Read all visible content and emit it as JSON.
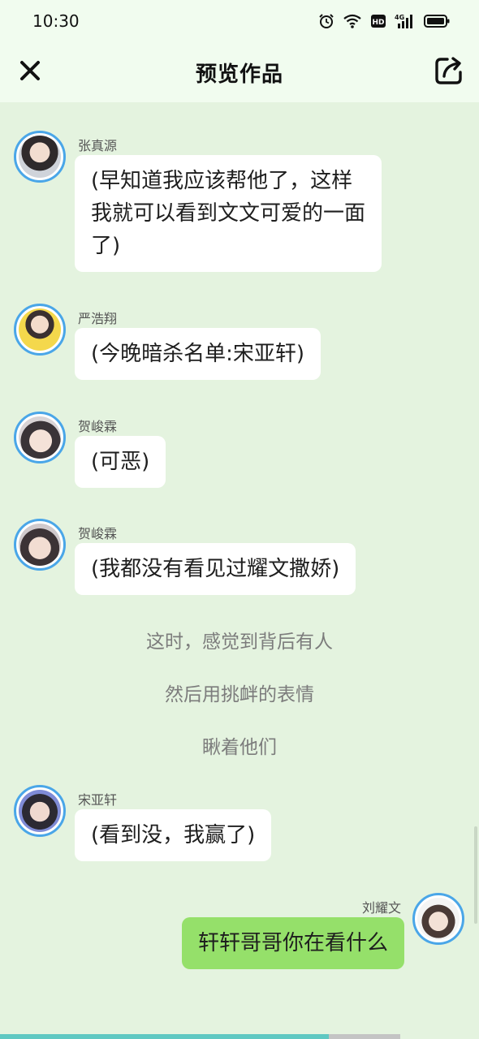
{
  "status_bar": {
    "time": "10:30",
    "icons": [
      "alarm-icon",
      "wifi-icon",
      "hd-icon",
      "signal-4g-icon",
      "battery-icon"
    ],
    "network_label": "4G",
    "hd_label": "HD"
  },
  "header": {
    "title": "预览作品",
    "close_icon": "close-icon",
    "share_icon": "share-icon"
  },
  "messages": [
    {
      "type": "left",
      "sender": "张真源",
      "lines": [
        "(早知道我应该帮他了，这样",
        "我就可以看到文文可爱的一面",
        "了)"
      ]
    },
    {
      "type": "left",
      "sender": "严浩翔",
      "lines": [
        "(今晚暗杀名单:宋亚轩)"
      ]
    },
    {
      "type": "left",
      "sender": "贺峻霖",
      "lines": [
        "(可恶)"
      ]
    },
    {
      "type": "left",
      "sender": "贺峻霖",
      "lines": [
        "(我都没有看见过耀文撒娇)"
      ]
    },
    {
      "type": "narration",
      "text": "这时，感觉到背后有人"
    },
    {
      "type": "narration",
      "text": "然后用挑衅的表情"
    },
    {
      "type": "narration",
      "text": "瞅着他们"
    },
    {
      "type": "left",
      "sender": "宋亚轩",
      "lines": [
        "(看到没，我赢了)"
      ]
    },
    {
      "type": "right",
      "sender": "刘耀文",
      "lines": [
        "轩轩哥哥你在看什么"
      ]
    }
  ],
  "colors": {
    "background": "#e4f3df",
    "header": "#f1fcef",
    "bubble_other": "#ffffff",
    "bubble_mine": "#95e06a",
    "avatar_ring": "#4aa6e8",
    "progress": "#5fc8c2"
  },
  "progress": {
    "fraction": 0.686
  }
}
